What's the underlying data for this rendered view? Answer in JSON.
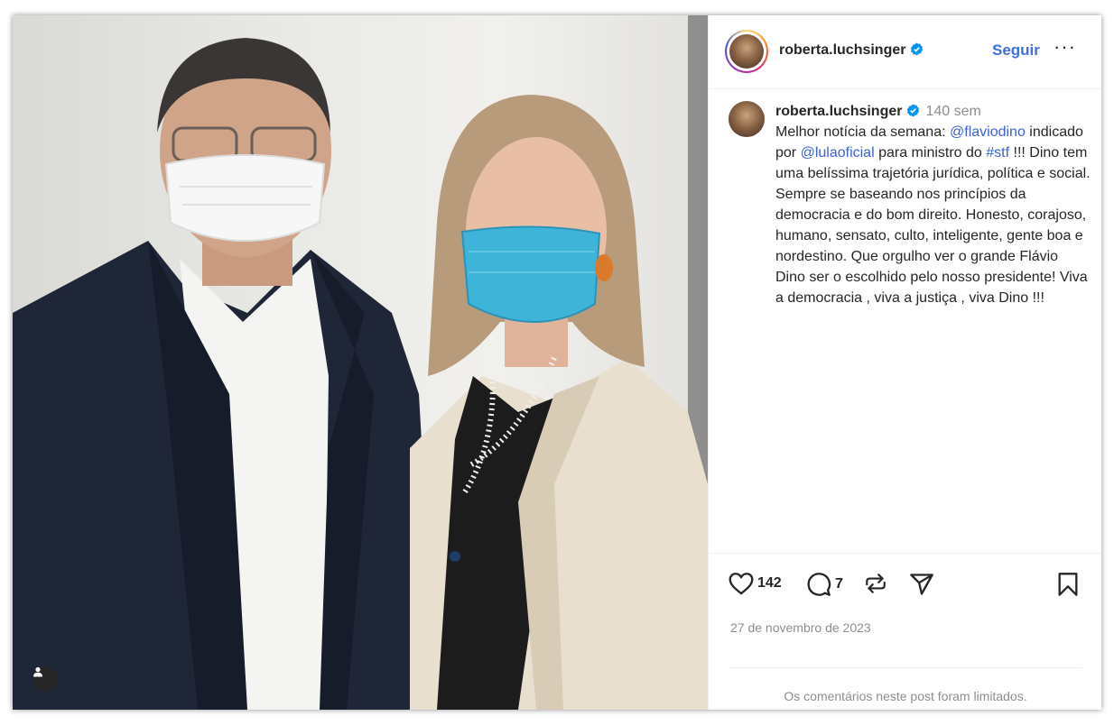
{
  "post": {
    "username": "roberta.luchsinger",
    "follow_label": "Seguir",
    "more_label": "···",
    "caption": {
      "username": "roberta.luchsinger",
      "time": "140 sem",
      "text_1": "Melhor notícia da semana: ",
      "mention_1": "@flaviodino",
      "text_2": " indicado por ",
      "mention_2": "@lulaoficial",
      "text_3": " para ministro do ",
      "hashtag": "#stf",
      "text_4": " !!! Dino tem uma belíssima trajetória jurídica, política e social. Sempre se baseando nos princípios da democracia e do bom direito. Honesto, corajoso, humano, sensato, culto, inteligente, gente boa e nordestino. Que orgulho ver o grande Flávio Dino ser o escolhido pelo nosso presidente! Viva a democracia , viva a justiça , viva Dino !!!"
    },
    "likes": "142",
    "comments": "7",
    "date": "27 de novembro de 2023",
    "comments_limited": "Os comentários neste post foram limitados."
  },
  "colors": {
    "link": "#3b62d6",
    "follow": "#3a6fe3",
    "verified": "#0095f6",
    "text": "#262626",
    "muted": "#8e8e8e"
  },
  "icons": [
    "verified-badge-icon",
    "heart-icon",
    "comment-icon",
    "repost-icon",
    "share-icon",
    "bookmark-icon",
    "user-tag-icon"
  ]
}
